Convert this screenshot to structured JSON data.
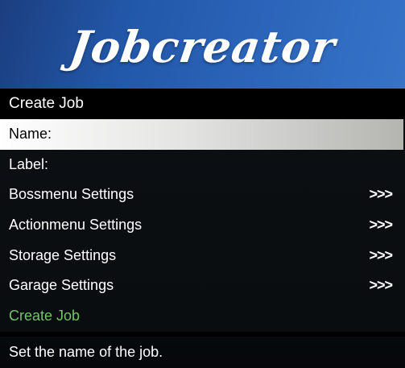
{
  "banner": {
    "title": "Jobcreator"
  },
  "menu": {
    "subtitle": "Create Job",
    "items": [
      {
        "label": "Name:",
        "arrow": ""
      },
      {
        "label": "Label:",
        "arrow": ""
      },
      {
        "label": "Bossmenu Settings",
        "arrow": ">>>"
      },
      {
        "label": "Actionmenu Settings",
        "arrow": ">>>"
      },
      {
        "label": "Storage Settings",
        "arrow": ">>>"
      },
      {
        "label": "Garage Settings",
        "arrow": ">>>"
      },
      {
        "label": "Create Job",
        "arrow": ""
      }
    ],
    "description": "Set the name of the job."
  },
  "colors": {
    "banner_start": "#1b3e7f",
    "banner_end": "#3674c8",
    "selected_highlight": "#e4e4e3",
    "accent_green": "#74c46a",
    "background": "#000000"
  }
}
